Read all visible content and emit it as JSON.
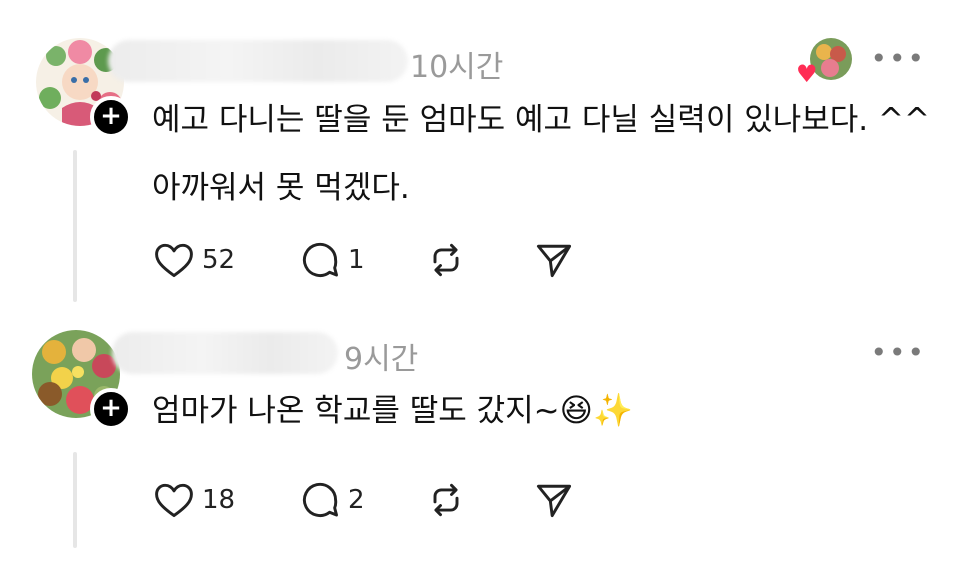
{
  "posts": [
    {
      "time": "10시간",
      "text": "예고 다니는 딸을 둔 엄마도 예고 다닐 실력이 있나보다. ^^\n아까워서 못 먹겠다.",
      "likes": "52",
      "replies": "1",
      "reactor_heart": "♥"
    },
    {
      "time": "9시간",
      "text": "엄마가 나온 학교를 딸도 갔지~",
      "emoji": "😆✨",
      "likes": "18",
      "replies": "2"
    }
  ],
  "icons": {
    "more": "•••",
    "follow": "+"
  },
  "colors": {
    "heart_accent": "#ff2d55",
    "muted_text": "#9a9a9a",
    "thread_line": "#e6e6e6"
  }
}
